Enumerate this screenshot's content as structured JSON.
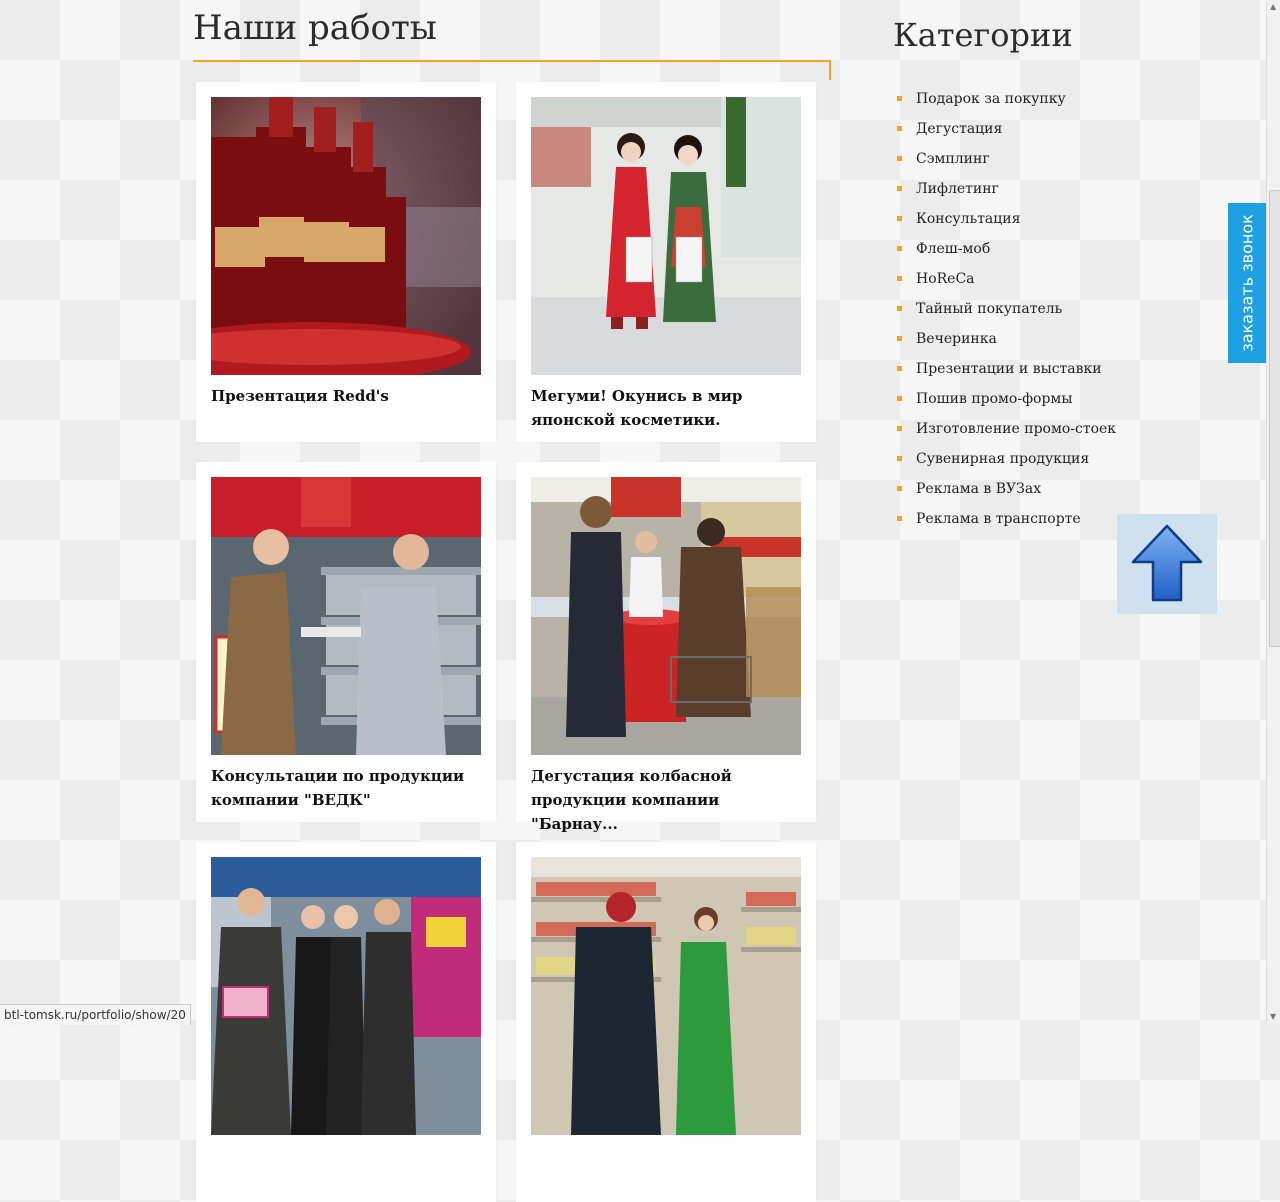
{
  "portfolio": {
    "title": "Наши работы",
    "items": [
      {
        "caption": "Презентация Redd's",
        "image_icon": "beer-bottles-photo"
      },
      {
        "caption": "Мегуми! Окунись в мир японской косметики.",
        "image_icon": "kimono-promoters-photo"
      },
      {
        "caption": "Консультации по продукции компании \"ВЕДК\"",
        "image_icon": "liquor-store-consultation-photo"
      },
      {
        "caption": "Дегустация колбасной продукции компании \"Барнау...",
        "image_icon": "sausage-tasting-photo"
      },
      {
        "caption": "",
        "image_icon": "promo-team-photo"
      },
      {
        "caption": "",
        "image_icon": "supermarket-promoter-photo"
      }
    ]
  },
  "categories": {
    "title": "Категории",
    "items": [
      "Подарок за покупку",
      "Дегустация",
      "Сэмплинг",
      "Лифлетинг",
      "Консультация",
      "Флеш-моб",
      "HoReCa",
      "Тайный покупатель",
      "Вечеринка",
      "Презентации и выставки",
      "Пошив промо-формы",
      "Изготовление промо-стоек",
      "Сувенирная продукция",
      "Реклама в ВУЗах",
      "Реклама в транспорте"
    ]
  },
  "callback": {
    "label": "заказать звонок"
  },
  "scroll_up": {
    "icon": "arrow-up-icon"
  },
  "status_bar": {
    "url": "btl-tomsk.ru/portfolio/show/20"
  },
  "colors": {
    "accent": "#f0a41f",
    "callback": "#1ea0e3"
  }
}
